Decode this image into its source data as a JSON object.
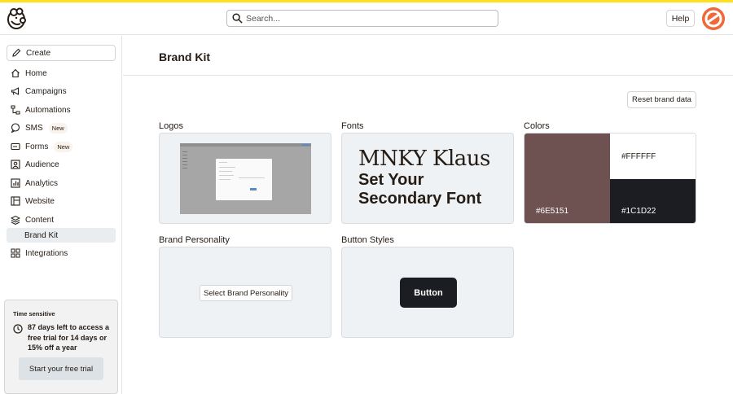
{
  "search": {
    "placeholder": "Search..."
  },
  "header": {
    "help_label": "Help"
  },
  "sidebar": {
    "create_label": "Create",
    "items": [
      {
        "label": "Home",
        "icon": "home-icon"
      },
      {
        "label": "Campaigns",
        "icon": "megaphone-icon"
      },
      {
        "label": "Automations",
        "icon": "automation-icon"
      },
      {
        "label": "SMS",
        "icon": "sms-icon",
        "badge": "New"
      },
      {
        "label": "Forms",
        "icon": "form-icon",
        "badge": "New"
      },
      {
        "label": "Audience",
        "icon": "audience-icon"
      },
      {
        "label": "Analytics",
        "icon": "analytics-icon"
      },
      {
        "label": "Website",
        "icon": "website-icon"
      },
      {
        "label": "Content",
        "icon": "content-icon"
      },
      {
        "label": "Brand Kit",
        "sub": true,
        "selected": true
      },
      {
        "label": "Integrations",
        "icon": "integrations-icon"
      }
    ]
  },
  "trial": {
    "label": "Time sensitive",
    "text": "87 days left to access a free trial for 14 days or 15% off a year",
    "button_label": "Start your free trial"
  },
  "page": {
    "title": "Brand Kit",
    "reset_label": "Reset brand data"
  },
  "sections": {
    "logos": "Logos",
    "fonts": "Fonts",
    "colors": "Colors",
    "personality": "Brand Personality",
    "button_styles": "Button Styles"
  },
  "fonts": {
    "heading": "MNKY Klaus",
    "secondary": "Set Your Secondary Font"
  },
  "colors": [
    {
      "label": "#6E5151",
      "hex": "#6E5151",
      "text_color": "#ffffff"
    },
    {
      "label": "#FFFFFF",
      "hex": "#FFFFFF",
      "text_color": "#241c15"
    },
    {
      "label": "#1C1D22",
      "hex": "#1C1D22",
      "text_color": "#ffffff"
    }
  ],
  "personality": {
    "button_label": "Select Brand Personality"
  },
  "button_styles": {
    "sample_label": "Button"
  },
  "accent": {
    "topstripe": "#ffe01b",
    "avatar": "#ef6a3a"
  }
}
